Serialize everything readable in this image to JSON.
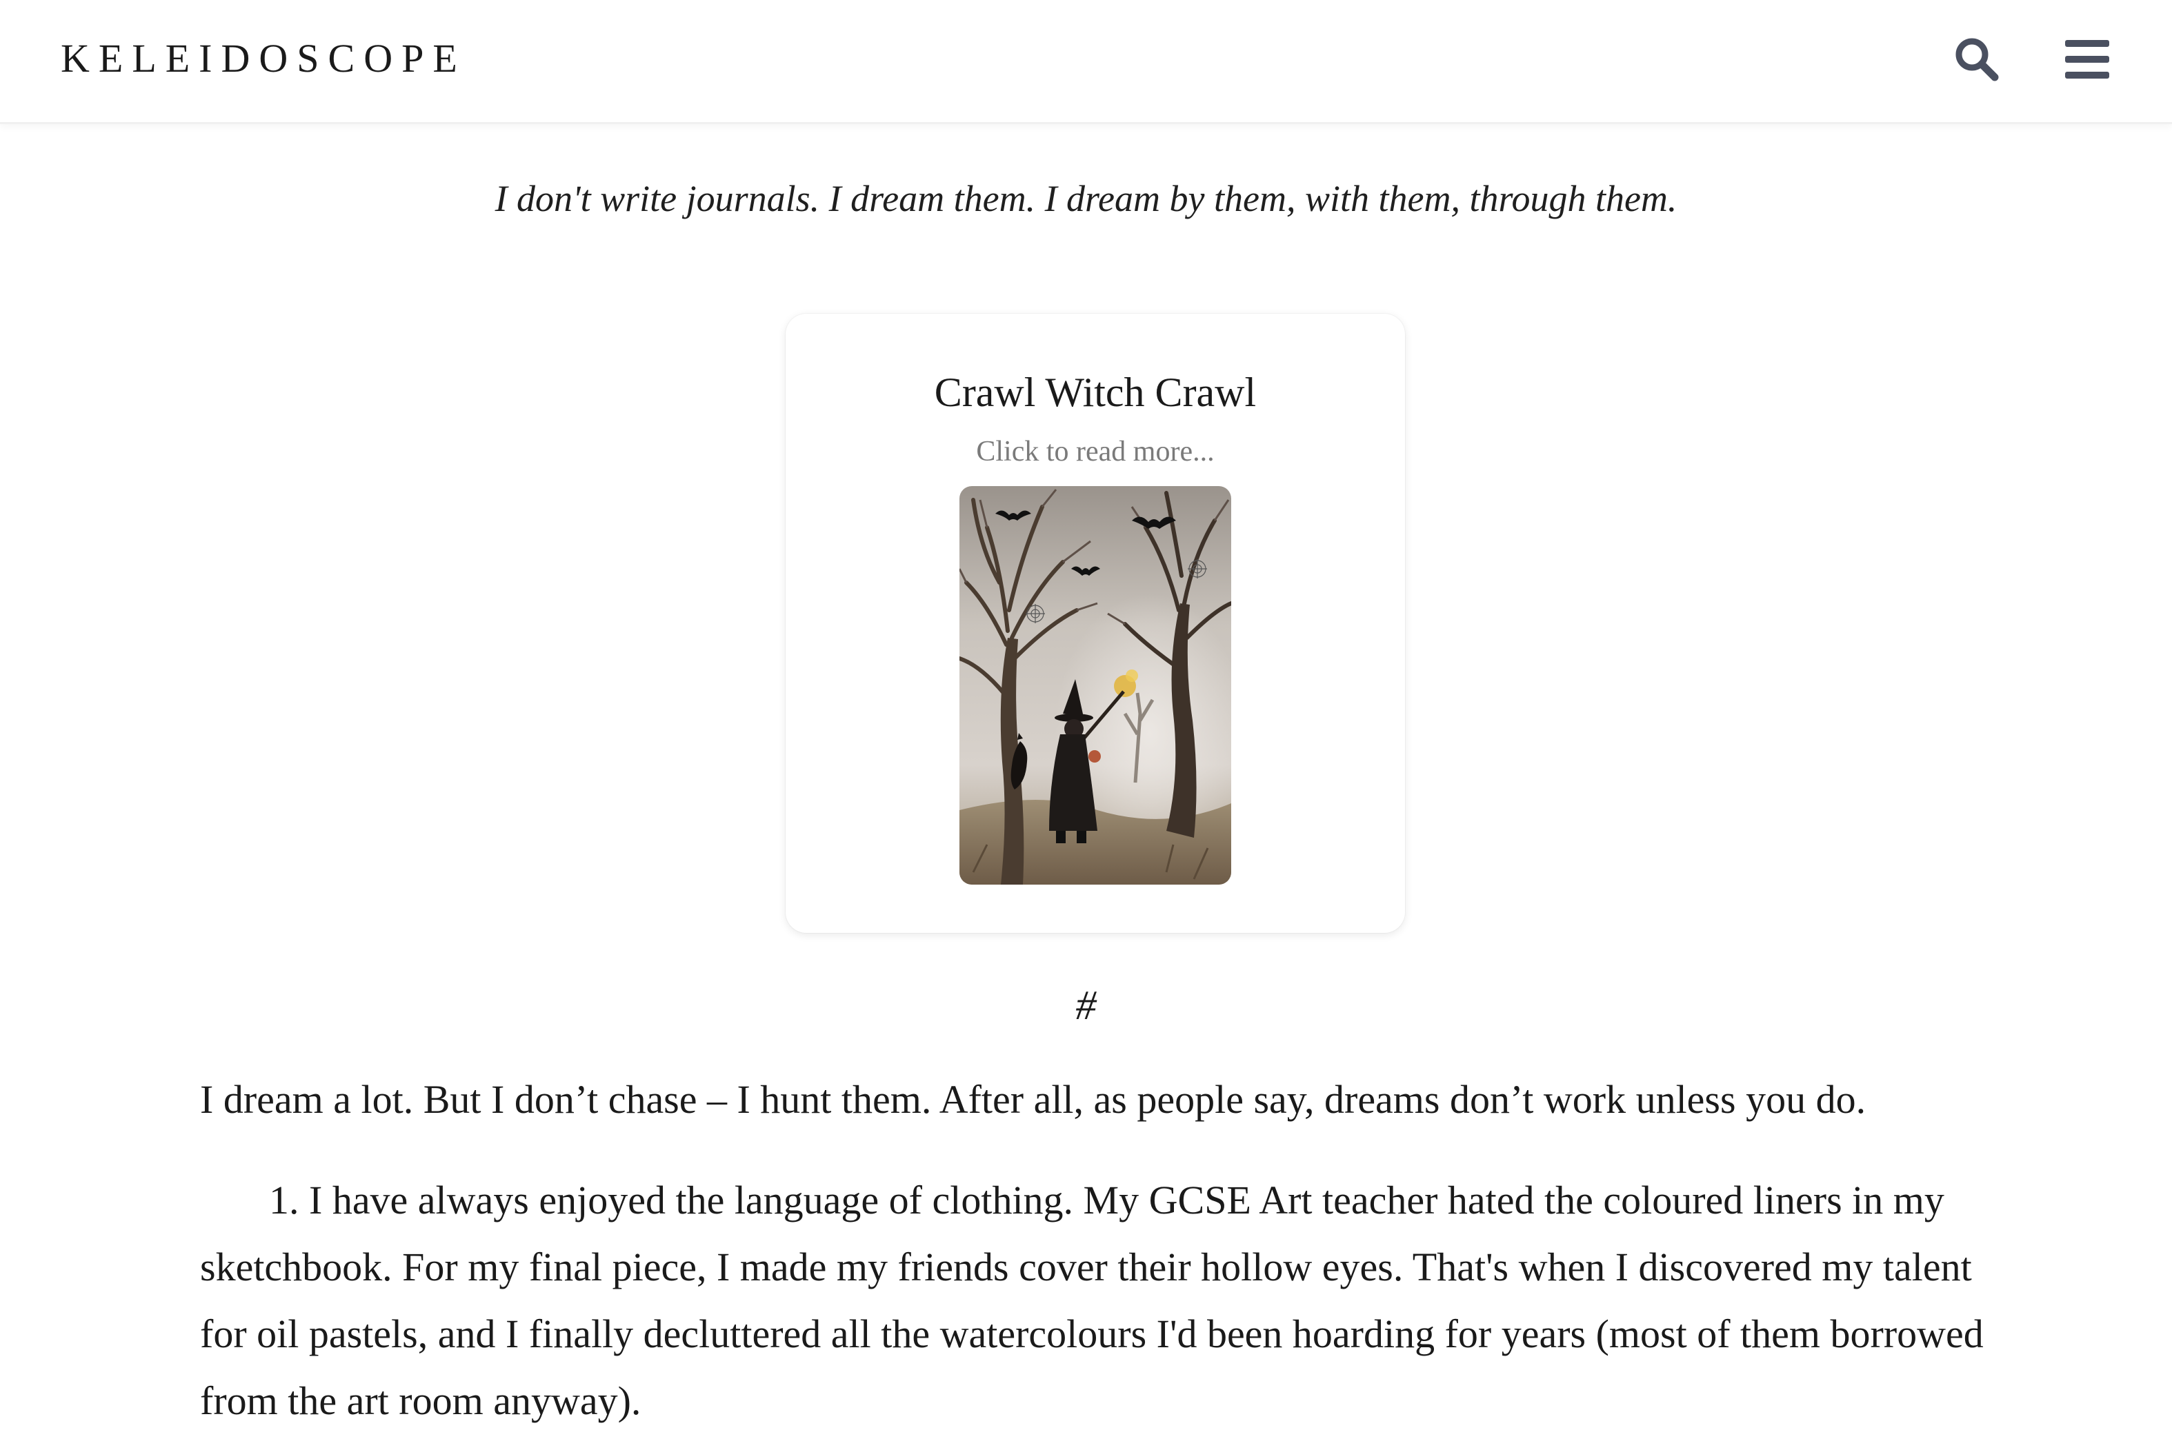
{
  "header": {
    "logo": "KELEIDOSCOPE",
    "search_icon": "search-icon",
    "menu_icon": "hamburger-menu-icon",
    "icon_color": "#4a5060"
  },
  "tagline": "I don't write journals. I dream them. I dream by them, with them, through them.",
  "card": {
    "title": "Crawl Witch Crawl",
    "subtitle": "Click to read more..."
  },
  "divider": "#",
  "body": {
    "paragraph_1": "I dream a lot. But I don’t chase – I hunt them. After all, as people say, dreams don’t work unless you do.",
    "paragraph_2": "1. I have always enjoyed the language of clothing. My GCSE Art teacher hated the coloured liners in my sketchbook. For my final piece, I made my friends cover their hollow eyes. That's when I discovered my talent for oil pastels, and I finally decluttered all the watercolours I'd been hoarding for years (most of them borrowed from the art room anyway)."
  }
}
